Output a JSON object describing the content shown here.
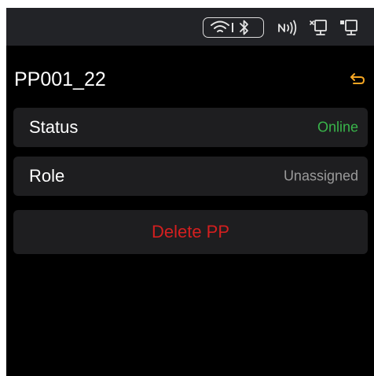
{
  "status_bar": {
    "icons": [
      "wifi-icon",
      "bluetooth-icon",
      "nfc-icon",
      "network-port-icon",
      "network-port-icon"
    ]
  },
  "header": {
    "title": "PP001_22",
    "back_icon": "back-arrow-icon"
  },
  "details": [
    {
      "label": "Status",
      "value": "Online",
      "value_color": "#39b54a"
    },
    {
      "label": "Role",
      "value": "Unassigned",
      "value_color": "#9a9a9a"
    }
  ],
  "actions": {
    "delete_label": "Delete PP",
    "delete_color": "#d41f1f"
  },
  "colors": {
    "accent": "#f5a623",
    "background": "#000000",
    "status_bar": "#222327",
    "card": "#1e1e20"
  }
}
